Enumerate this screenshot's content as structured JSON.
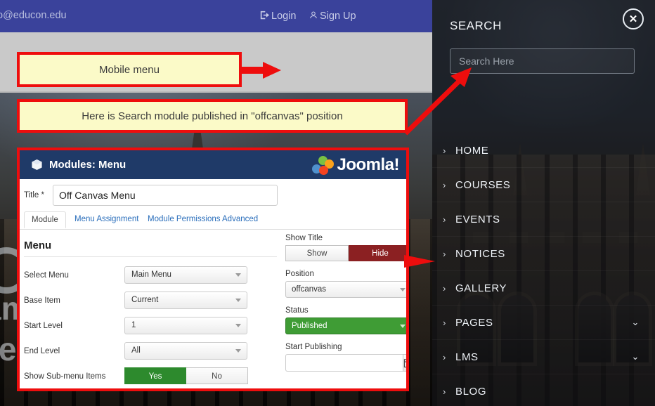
{
  "site": {
    "topbar": {
      "email": "fo@educon.edu",
      "login": "Login",
      "signup": "Sign Up",
      "login_icon": "sign-in-icon",
      "signup_icon": "user-icon",
      "bg_color": "#3a429b"
    },
    "navbar": {
      "hamburger_icon": "hamburger-menu-icon",
      "search_icon": "search-icon",
      "bg_color": "#c9c9c9"
    }
  },
  "annotations": {
    "mobile_menu": "Mobile menu",
    "search_module": "Here is Search module published in \"offcanvas\" position",
    "box_fill": "#fbfac8",
    "box_border": "#ee0d0d",
    "arrow_color": "#ee0d0d"
  },
  "joomla": {
    "header": {
      "title": "Modules: Menu",
      "icon": "cube-icon",
      "brand": "Joomla!",
      "brand_mark_icon": "joomla-logo-icon",
      "bg_color": "#1f3a68"
    },
    "title_field": {
      "label": "Title *",
      "value": "Off Canvas Menu"
    },
    "tabs": [
      {
        "label": "Module",
        "active": true
      },
      {
        "label": "Menu Assignment",
        "active": false
      },
      {
        "label": "Module Permissions",
        "active": false
      },
      {
        "label": "Advanced",
        "active": false
      }
    ],
    "section_title": "Menu",
    "fields": [
      {
        "label": "Select Menu",
        "value": "Main Menu",
        "type": "select"
      },
      {
        "label": "Base Item",
        "value": "Current",
        "type": "select"
      },
      {
        "label": "Start Level",
        "value": "1",
        "type": "select"
      },
      {
        "label": "End Level",
        "value": "All",
        "type": "select"
      }
    ],
    "submenu": {
      "label": "Show Sub-menu Items",
      "yes": "Yes",
      "no": "No",
      "selected": "Yes",
      "on_color": "#2d8a2d"
    },
    "right": {
      "show_title": {
        "label": "Show Title",
        "show": "Show",
        "hide": "Hide",
        "selected": "Hide",
        "selected_color": "#8b2022"
      },
      "position": {
        "label": "Position",
        "value": "offcanvas"
      },
      "status": {
        "label": "Status",
        "value": "Published",
        "color": "#3f9c35"
      },
      "start_publishing": {
        "label": "Start Publishing",
        "value": "",
        "calendar_icon": "calendar-icon"
      }
    }
  },
  "offcanvas": {
    "close_icon": "close-icon",
    "search_heading": "SEARCH",
    "search_placeholder": "Search Here",
    "search_value": "",
    "menu": [
      {
        "label": "HOME",
        "has_submenu": false
      },
      {
        "label": "COURSES",
        "has_submenu": false
      },
      {
        "label": "EVENTS",
        "has_submenu": false
      },
      {
        "label": "NOTICES",
        "has_submenu": false
      },
      {
        "label": "GALLERY",
        "has_submenu": false
      },
      {
        "label": "PAGES",
        "has_submenu": true
      },
      {
        "label": "LMS",
        "has_submenu": true
      },
      {
        "label": "BLOG",
        "has_submenu": false
      }
    ],
    "chevron_icon": "chevron-right-icon",
    "expand_icon": "chevron-down-icon"
  }
}
